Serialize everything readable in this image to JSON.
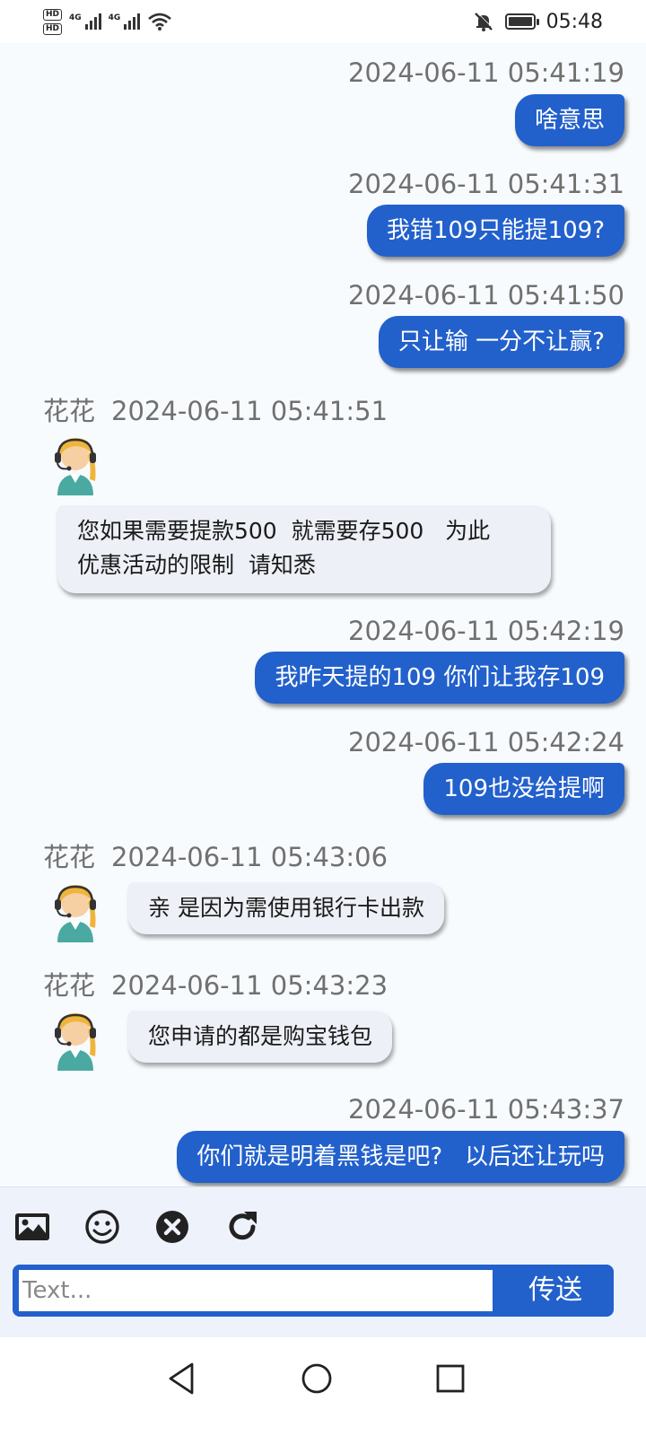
{
  "status_bar": {
    "hd1": "HD",
    "hd2": "HD",
    "net1": "4G",
    "net2": "4G",
    "time": "05:48",
    "icons": [
      "hd-icon",
      "signal-icon",
      "signal-icon",
      "wifi-icon",
      "mute-bell-icon",
      "battery-icon"
    ]
  },
  "messages": [
    {
      "type": "out",
      "timestamp": "2024-06-11 05:41:19",
      "text": "啥意思"
    },
    {
      "type": "out",
      "timestamp": "2024-06-11 05:41:31",
      "text": "我错109只能提109?"
    },
    {
      "type": "out",
      "timestamp": "2024-06-11 05:41:50",
      "text": "只让输 一分不让赢?"
    },
    {
      "type": "in",
      "sender": "花花",
      "timestamp": "2024-06-11 05:41:51",
      "line1": "您如果需要提款500  就需要存500   为此",
      "line2": "优惠活动的限制  请知悉"
    },
    {
      "type": "out",
      "timestamp": "2024-06-11 05:42:19",
      "text": "我昨天提的109 你们让我存109"
    },
    {
      "type": "out",
      "timestamp": "2024-06-11 05:42:24",
      "text": "109也没给提啊"
    },
    {
      "type": "in",
      "sender": "花花",
      "timestamp": "2024-06-11 05:43:06",
      "text": "亲 是因为需使用银行卡出款"
    },
    {
      "type": "in",
      "sender": "花花",
      "timestamp": "2024-06-11 05:43:23",
      "text": "您申请的都是购宝钱包"
    },
    {
      "type": "out",
      "timestamp": "2024-06-11 05:43:37",
      "text": "你们就是明着黑钱是吧?   以后还让玩吗"
    }
  ],
  "composer": {
    "tools": [
      "image-icon",
      "emoji-icon",
      "close-circle-icon",
      "refresh-icon"
    ],
    "placeholder": "Text...",
    "send_label": "传送"
  },
  "colors": {
    "accent": "#2260cc",
    "incoming_bubble": "#eef0f7",
    "background": "#f8fbfe"
  }
}
